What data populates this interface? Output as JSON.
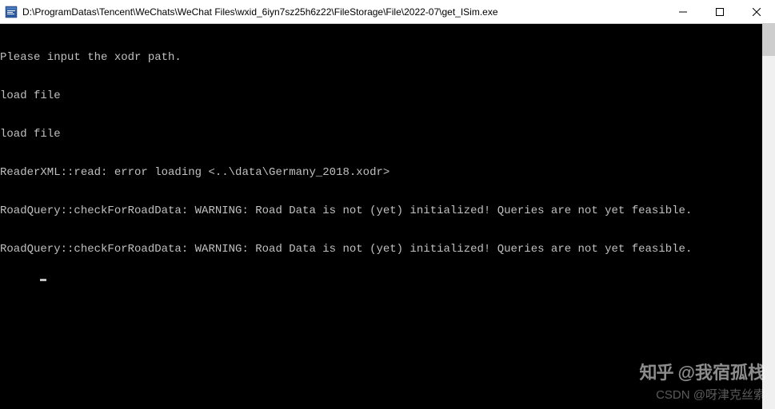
{
  "titlebar": {
    "path": "D:\\ProgramDatas\\Tencent\\WeChats\\WeChat Files\\wxid_6iyn7sz25h6z22\\FileStorage\\File\\2022-07\\get_ISim.exe"
  },
  "console": {
    "lines": [
      "Please input the xodr path.",
      "load file",
      "load file",
      "ReaderXML::read: error loading <..\\data\\Germany_2018.xodr>",
      "RoadQuery::checkForRoadData: WARNING: Road Data is not (yet) initialized! Queries are not yet feasible.",
      "RoadQuery::checkForRoadData: WARNING: Road Data is not (yet) initialized! Queries are not yet feasible."
    ]
  },
  "watermarks": {
    "zhihu_logo": "知乎",
    "zhihu_user": "@我宿孤栈",
    "csdn": "CSDN @呀津克丝索"
  }
}
